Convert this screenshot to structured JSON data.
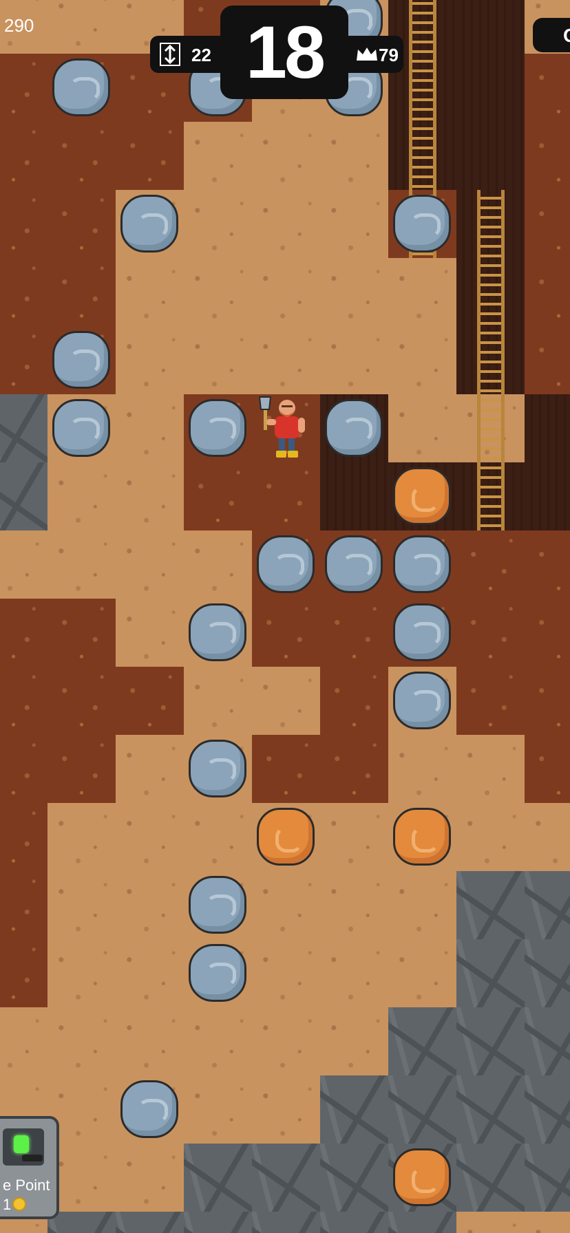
{
  "hud": {
    "score": "290",
    "depth": "22",
    "timer": "18",
    "best": "79",
    "right_partial": "C"
  },
  "checkpoint": {
    "label": "e Point",
    "cost": "1"
  },
  "icons": {
    "depth": "depth-arrow-icon",
    "best": "crown-icon",
    "coin": "coin-icon"
  },
  "palette": {
    "light_dirt": "#c9935f",
    "dark_dirt": "#7e3a1f",
    "tunnel": "#3b1e14",
    "rock": "#5f6469",
    "boulder": "#8ca4b9",
    "ore": "#e48a3c",
    "hud": "#111111",
    "checkpoint_light": "#5cf048"
  },
  "grid_rows": [
    "LLLDDLTTLL",
    "DDDDLLTTDL",
    "DDDLLLTTDL",
    "DDLLLLDTDD",
    "DDLLLLLTDD",
    "DDLLLLLTDD",
    "RLLDDTLLTD",
    "RLLDDTTTTD",
    "LLLLDDDDDL",
    "DDLLDDDDDR",
    "DDDLLDLDDR",
    "DDLLDDLLDR",
    "DLLLLLLLLR",
    "DLLLLLLRRR",
    "DLLLLLLRRR",
    "LLLLLLRRRR",
    "LLLLLRRRRR",
    "LLLRRRRRRL",
    "LRRRRRRLLL"
  ],
  "ladders": [
    {
      "col": 6,
      "from_row": 0,
      "to_row": 3
    },
    {
      "col": 7,
      "from_row": 3,
      "to_row": 7
    }
  ],
  "boulders": [
    [
      5,
      0
    ],
    [
      1,
      1
    ],
    [
      3,
      1
    ],
    [
      5,
      1
    ],
    [
      2,
      3
    ],
    [
      6,
      3
    ],
    [
      1,
      5
    ],
    [
      1,
      6
    ],
    [
      3,
      6
    ],
    [
      5,
      6
    ],
    [
      4,
      8
    ],
    [
      5,
      8
    ],
    [
      6,
      8
    ],
    [
      3,
      9
    ],
    [
      6,
      9
    ],
    [
      6,
      10
    ],
    [
      3,
      11
    ],
    [
      3,
      13
    ],
    [
      3,
      14
    ],
    [
      2,
      16
    ]
  ],
  "ores": [
    [
      6,
      7
    ],
    [
      4,
      12
    ],
    [
      6,
      12
    ],
    [
      6,
      17
    ]
  ],
  "miner": {
    "col": 4,
    "row": 6
  }
}
